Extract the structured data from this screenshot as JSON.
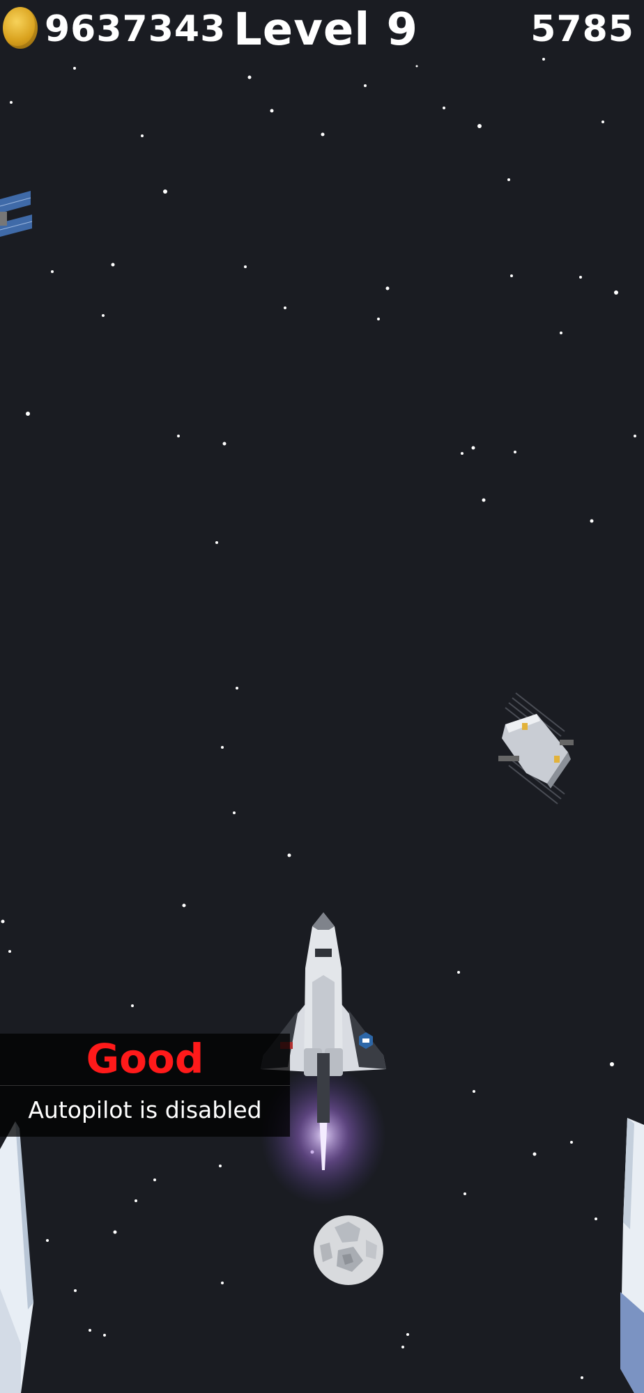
{
  "hud": {
    "coins": "9637343",
    "level": "Level 9",
    "score": "5785",
    "coin_icon": "gold-coin-icon"
  },
  "toast": {
    "rating": "Good",
    "message": "Autopilot is disabled",
    "rating_color": "#ff1a1a"
  },
  "colors": {
    "background": "#1a1c22",
    "text": "#ffffff"
  },
  "objects": [
    "space-shuttle",
    "satellite",
    "solar-panel-debris",
    "asteroid",
    "crystal-pillar-left",
    "crystal-pillar-right"
  ]
}
